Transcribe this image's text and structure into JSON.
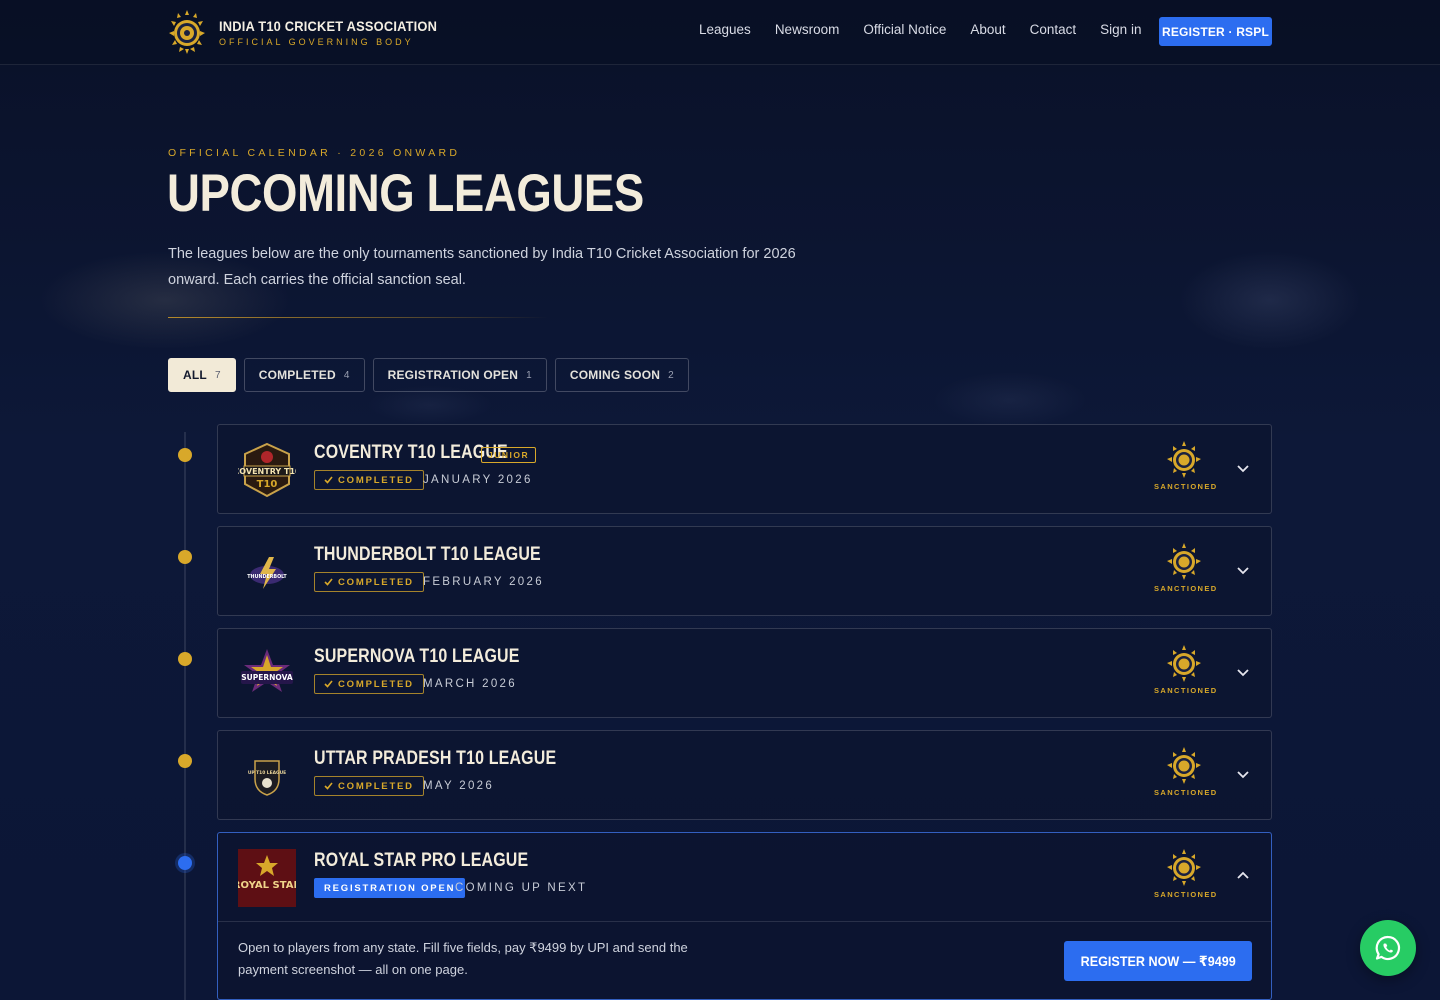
{
  "header": {
    "brand_title": "INDIA T10 CRICKET ASSOCIATION",
    "brand_subtitle": "OFFICIAL GOVERNING BODY",
    "logo_icon": "seal-emblem-icon",
    "nav": [
      "Leagues",
      "Newsroom",
      "Official Notice",
      "About",
      "Contact",
      "Sign in"
    ],
    "register_button": "REGISTER · RSPL"
  },
  "hero": {
    "eyebrow": "OFFICIAL CALENDAR · 2026 ONWARD",
    "title": "UPCOMING LEAGUES",
    "description": "The leagues below are the only tournaments sanctioned by India T10 Cricket Association for 2026 onward. Each carries the official sanction seal."
  },
  "filters": [
    {
      "label": "ALL",
      "count": "7",
      "active": true
    },
    {
      "label": "COMPLETED",
      "count": "4",
      "active": false
    },
    {
      "label": "REGISTRATION OPEN",
      "count": "1",
      "active": false
    },
    {
      "label": "COMING SOON",
      "count": "2",
      "active": false
    }
  ],
  "leagues": [
    {
      "name": "COVENTRY T10 LEAGUE",
      "tag": "JUNIOR",
      "status": "COMPLETED",
      "date": "JANUARY 2026",
      "seal_label": "SANCTIONED",
      "logo_text": "COVENTRY T10"
    },
    {
      "name": "THUNDERBOLT T10 LEAGUE",
      "status": "COMPLETED",
      "date": "FEBRUARY 2026",
      "seal_label": "SANCTIONED",
      "logo_text": "THUNDERBOLT"
    },
    {
      "name": "SUPERNOVA T10 LEAGUE",
      "status": "COMPLETED",
      "date": "MARCH 2026",
      "seal_label": "SANCTIONED",
      "logo_text": "SUPERNOVA"
    },
    {
      "name": "UTTAR PRADESH T10 LEAGUE",
      "status": "COMPLETED",
      "date": "MAY 2026",
      "seal_label": "SANCTIONED",
      "logo_text": "UP T10 LEAGUE"
    },
    {
      "name": "ROYAL STAR PRO LEAGUE",
      "status": "REGISTRATION OPEN",
      "date": "COMING UP NEXT",
      "seal_label": "SANCTIONED",
      "logo_text": "ROYAL STAR",
      "detail": "Open to players from any state. Fill five fields, pay ₹9499 by UPI and send the payment screenshot — all on one page.",
      "cta": "REGISTER NOW — ₹9499"
    }
  ],
  "colors": {
    "gold": "#d8a82a",
    "blue": "#2c6df0",
    "background": "#0b1330",
    "whatsapp": "#27cc64"
  },
  "floating_action": "whatsapp-icon"
}
